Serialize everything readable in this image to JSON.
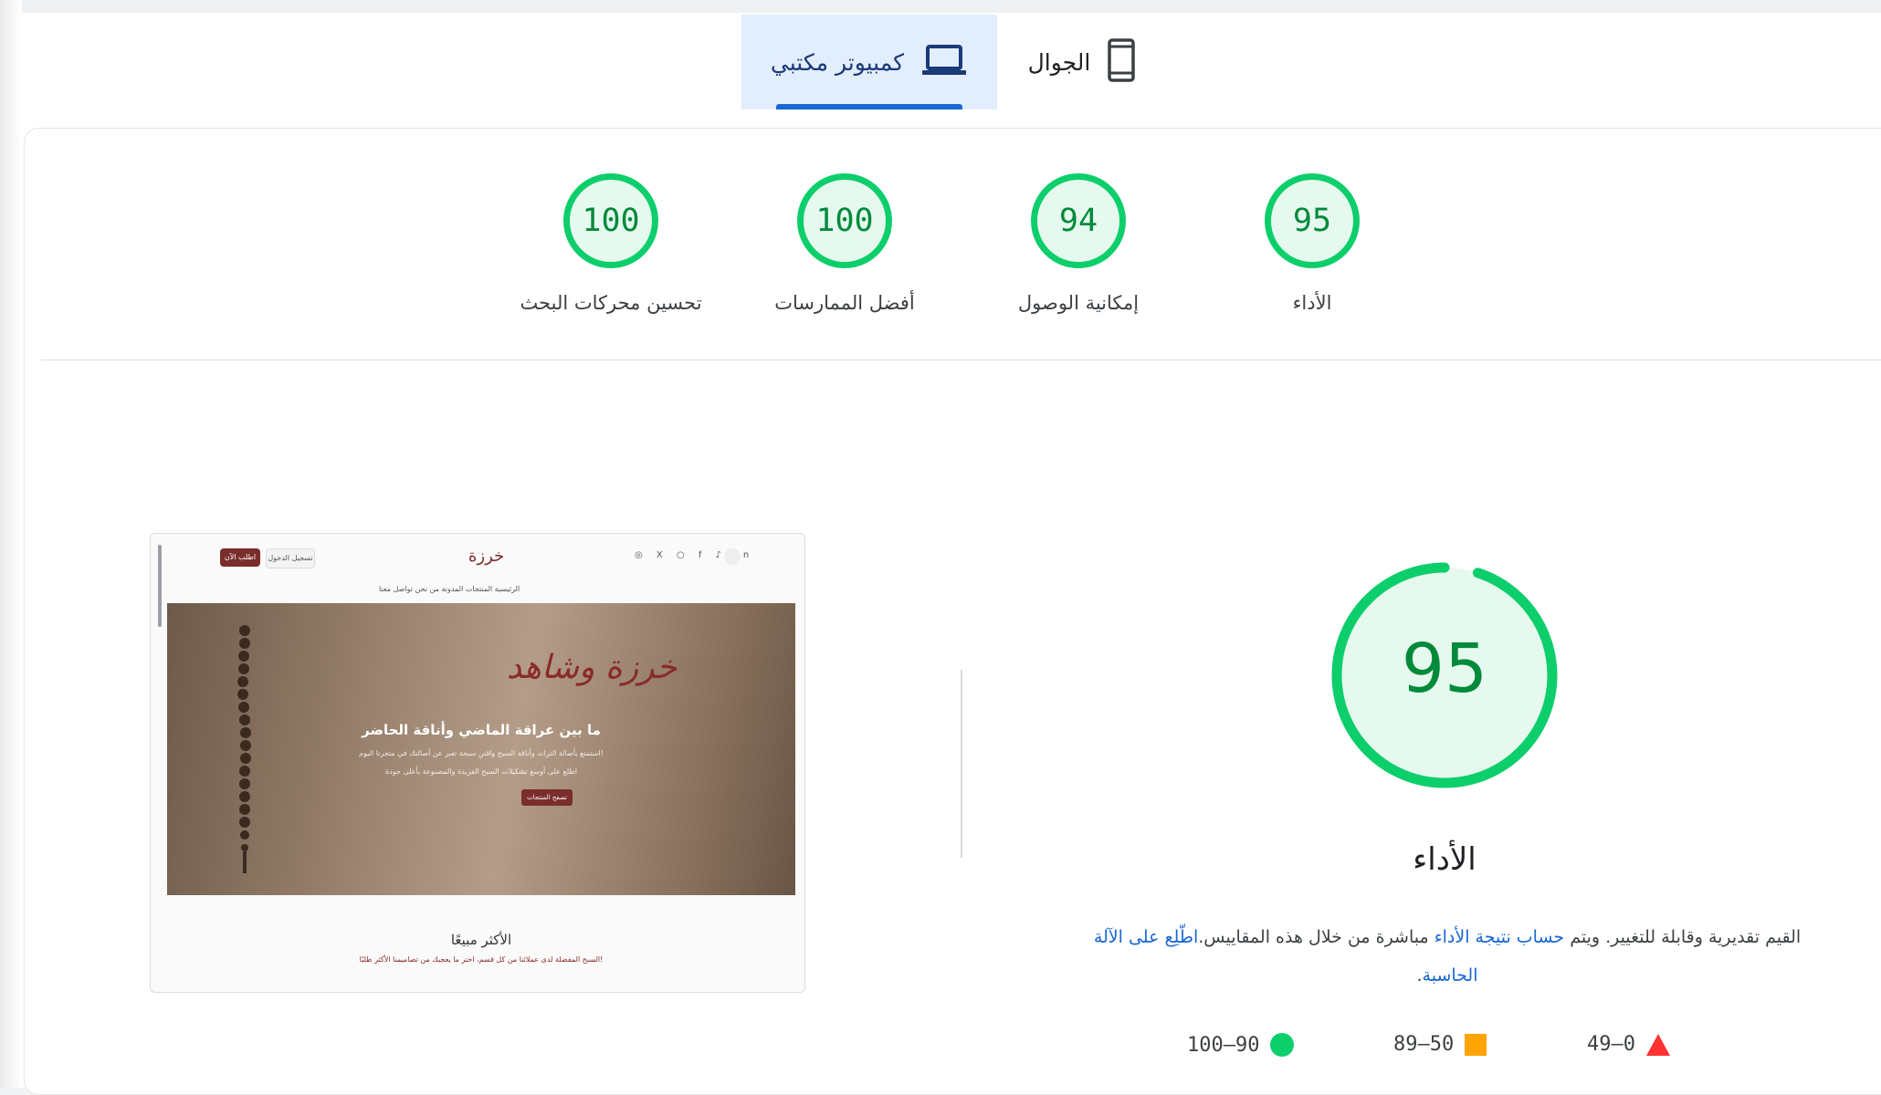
{
  "tabs": {
    "desktop_label": "كمبيوتر مكتبي",
    "mobile_label": "الجوال"
  },
  "scores": [
    {
      "title": "الأداء",
      "value": "95"
    },
    {
      "title": "إمكانية الوصول",
      "value": "94"
    },
    {
      "title": "أفضل الممارسات",
      "value": "100"
    },
    {
      "title": "تحسين محركات البحث",
      "value": "100"
    }
  ],
  "performance": {
    "value": "95",
    "fraction": 0.95,
    "title": "الأداء",
    "desc_prefix": "القيم تقديرية وقابلة للتغيير. ويتم ",
    "desc_link_calc": "حساب نتيجة الأداء",
    "desc_middle": " مباشرة من خلال هذه المقاييس.",
    "desc_link_calculator": "اطّلِع على الآلة الحاسبة",
    "desc_suffix": "."
  },
  "legend": {
    "fail": "49–0",
    "average": "89–50",
    "pass": "100–90"
  },
  "thumbnail": {
    "order_button": "اطلب الآن",
    "login_button": "تسجيل الدخول",
    "logo": "خرزة",
    "social": "◎ X ○ f ♪ in",
    "menu": "الرئيسية   المنتجات   المدونة   من نحن   تواصل معنا",
    "hero_script": "خرزة وشاهد",
    "hero_title": "ما بين عراقة الماضي وأناقة الحاضر",
    "hero_line1": "استمتع بأصالة التراث وأناقة السبح واقتنِ سبحة تعبر عن أصالتك في متجرنا اليوم!",
    "hero_line2": "اطلع على أوسع تشكيلات السبح الفريدة والمصنوعة بأعلى جودة",
    "hero_button": "تصفح المنتجات",
    "section_title": "الأكثر مبيعًا",
    "section_sub": "السبح المفضلة لدى عملائنا من كل قسم، اختر ما يعجبك من تصاميمنا الأكثر طلبًا!"
  },
  "colors": {
    "pass": "#0cce6b",
    "pass_text": "#008a3a",
    "average": "#ffa400",
    "fail": "#ff3333",
    "accent": "#1967d2"
  }
}
